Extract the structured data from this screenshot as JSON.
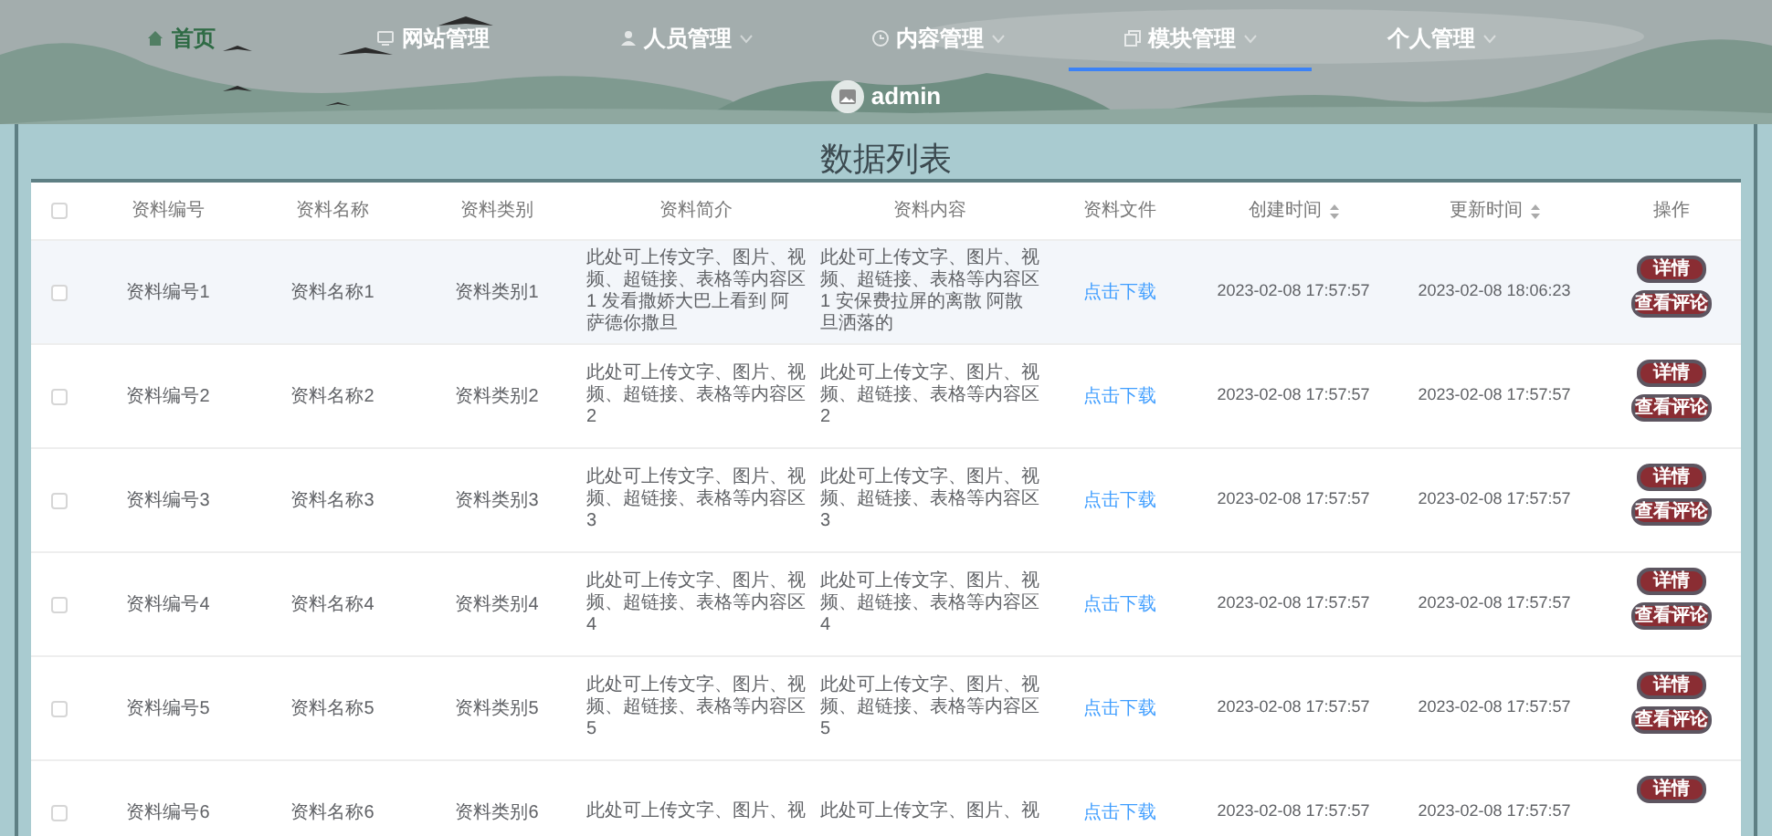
{
  "nav": [
    {
      "label": "首页",
      "selected": false,
      "dropdown": false
    },
    {
      "label": "网站管理",
      "selected": false,
      "dropdown": false
    },
    {
      "label": "人员管理",
      "selected": false,
      "dropdown": true
    },
    {
      "label": "内容管理",
      "selected": false,
      "dropdown": true
    },
    {
      "label": "模块管理",
      "selected": true,
      "dropdown": true
    },
    {
      "label": "个人管理",
      "selected": false,
      "dropdown": true
    }
  ],
  "user": {
    "name": "admin"
  },
  "title": "数据列表",
  "table": {
    "columns": [
      {
        "label": "资料编号",
        "sortable": false
      },
      {
        "label": "资料名称",
        "sortable": false
      },
      {
        "label": "资料类别",
        "sortable": false
      },
      {
        "label": "资料简介",
        "sortable": false
      },
      {
        "label": "资料内容",
        "sortable": false
      },
      {
        "label": "资料文件",
        "sortable": false
      },
      {
        "label": "创建时间",
        "sortable": true
      },
      {
        "label": "更新时间",
        "sortable": true
      },
      {
        "label": "操作",
        "sortable": false
      }
    ],
    "header_checked": false,
    "rows": [
      {
        "checked": false,
        "highlighted": true,
        "cells": [
          "资料编号1",
          "资料名称1",
          "资料类别1",
          "此处可上传文字、图片、视频、超链接、表格等内容区1 发看撒娇大巴上看到 阿萨德你撒旦",
          "此处可上传文字、图片、视频、超链接、表格等内容区1 安保费拉屏的离散 阿散旦洒落的",
          "点击下载",
          "2023-02-08 17:57:57",
          "2023-02-08 18:06:23"
        ],
        "actions": [
          "详情",
          "查看评论"
        ]
      },
      {
        "checked": false,
        "highlighted": false,
        "cells": [
          "资料编号2",
          "资料名称2",
          "资料类别2",
          "此处可上传文字、图片、视频、超链接、表格等内容区2",
          "此处可上传文字、图片、视频、超链接、表格等内容区2",
          "点击下载",
          "2023-02-08 17:57:57",
          "2023-02-08 17:57:57"
        ],
        "actions": [
          "详情",
          "查看评论"
        ]
      },
      {
        "checked": false,
        "highlighted": false,
        "cells": [
          "资料编号3",
          "资料名称3",
          "资料类别3",
          "此处可上传文字、图片、视频、超链接、表格等内容区3",
          "此处可上传文字、图片、视频、超链接、表格等内容区3",
          "点击下载",
          "2023-02-08 17:57:57",
          "2023-02-08 17:57:57"
        ],
        "actions": [
          "详情",
          "查看评论"
        ]
      },
      {
        "checked": false,
        "highlighted": false,
        "cells": [
          "资料编号4",
          "资料名称4",
          "资料类别4",
          "此处可上传文字、图片、视频、超链接、表格等内容区4",
          "此处可上传文字、图片、视频、超链接、表格等内容区4",
          "点击下载",
          "2023-02-08 17:57:57",
          "2023-02-08 17:57:57"
        ],
        "actions": [
          "详情",
          "查看评论"
        ]
      },
      {
        "checked": false,
        "highlighted": false,
        "cells": [
          "资料编号5",
          "资料名称5",
          "资料类别5",
          "此处可上传文字、图片、视频、超链接、表格等内容区5",
          "此处可上传文字、图片、视频、超链接、表格等内容区5",
          "点击下载",
          "2023-02-08 17:57:57",
          "2023-02-08 17:57:57"
        ],
        "actions": [
          "详情",
          "查看评论"
        ]
      },
      {
        "checked": false,
        "highlighted": false,
        "cells": [
          "资料编号6",
          "资料名称6",
          "资料类别6",
          "此处可上传文字、图片、视",
          "此处可上传文字、图片、视",
          "点击下载",
          "2023-02-08 17:57:57",
          "2023-02-08 17:57:57"
        ],
        "actions": [
          "详情"
        ]
      }
    ]
  }
}
